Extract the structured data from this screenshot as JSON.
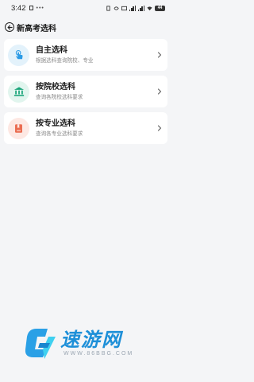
{
  "status_bar": {
    "time": "3:42",
    "dots": "•••",
    "battery": "44"
  },
  "header": {
    "title": "新高考选科"
  },
  "cards": [
    {
      "title": "自主选科",
      "desc": "根据选科查询院校、专业",
      "icon": "hand-tap-icon",
      "bg": "#e3f2fb",
      "fg": "#2b9be6"
    },
    {
      "title": "按院校选科",
      "desc": "查询各院校选科要求",
      "icon": "school-building-icon",
      "bg": "#e1f5ee",
      "fg": "#1aa57a"
    },
    {
      "title": "按专业选科",
      "desc": "查询各专业选科要求",
      "icon": "book-icon",
      "bg": "#fde8e3",
      "fg": "#ea6b4f"
    }
  ],
  "watermark": {
    "name": "速游网",
    "url": "WWW.86BBG.COM"
  }
}
